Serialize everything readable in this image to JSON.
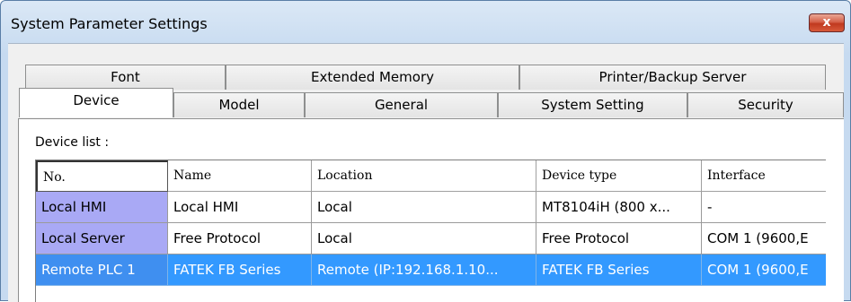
{
  "window": {
    "title": "System Parameter Settings",
    "close_label": "x"
  },
  "tabs": {
    "back_row": [
      "Font",
      "Extended Memory",
      "Printer/Backup Server"
    ],
    "front_row": [
      "Device",
      "Model",
      "General",
      "System Setting",
      "Security"
    ],
    "selected": "Device"
  },
  "device_list": {
    "label": "Device list :",
    "columns": [
      "No.",
      "Name",
      "Location",
      "Device type",
      "Interface"
    ],
    "rows": [
      {
        "no": "Local HMI",
        "name": "Local HMI",
        "location": "Local",
        "device_type": "MT8104iH (800 x...",
        "interface": "-"
      },
      {
        "no": "Local Server",
        "name": "Free Protocol",
        "location": "Local",
        "device_type": "Free Protocol",
        "interface": "COM 1 (9600,E"
      },
      {
        "no": "Remote PLC 1",
        "name": "FATEK FB Series",
        "location": "Remote (IP:192.168.1.10...",
        "device_type": "FATEK FB Series",
        "interface": "COM 1 (9600,E"
      }
    ],
    "selected_row": 3
  },
  "colors": {
    "row_header": "#a9a9f5",
    "selection": "#3399ff",
    "close_button": "#c0391f"
  }
}
